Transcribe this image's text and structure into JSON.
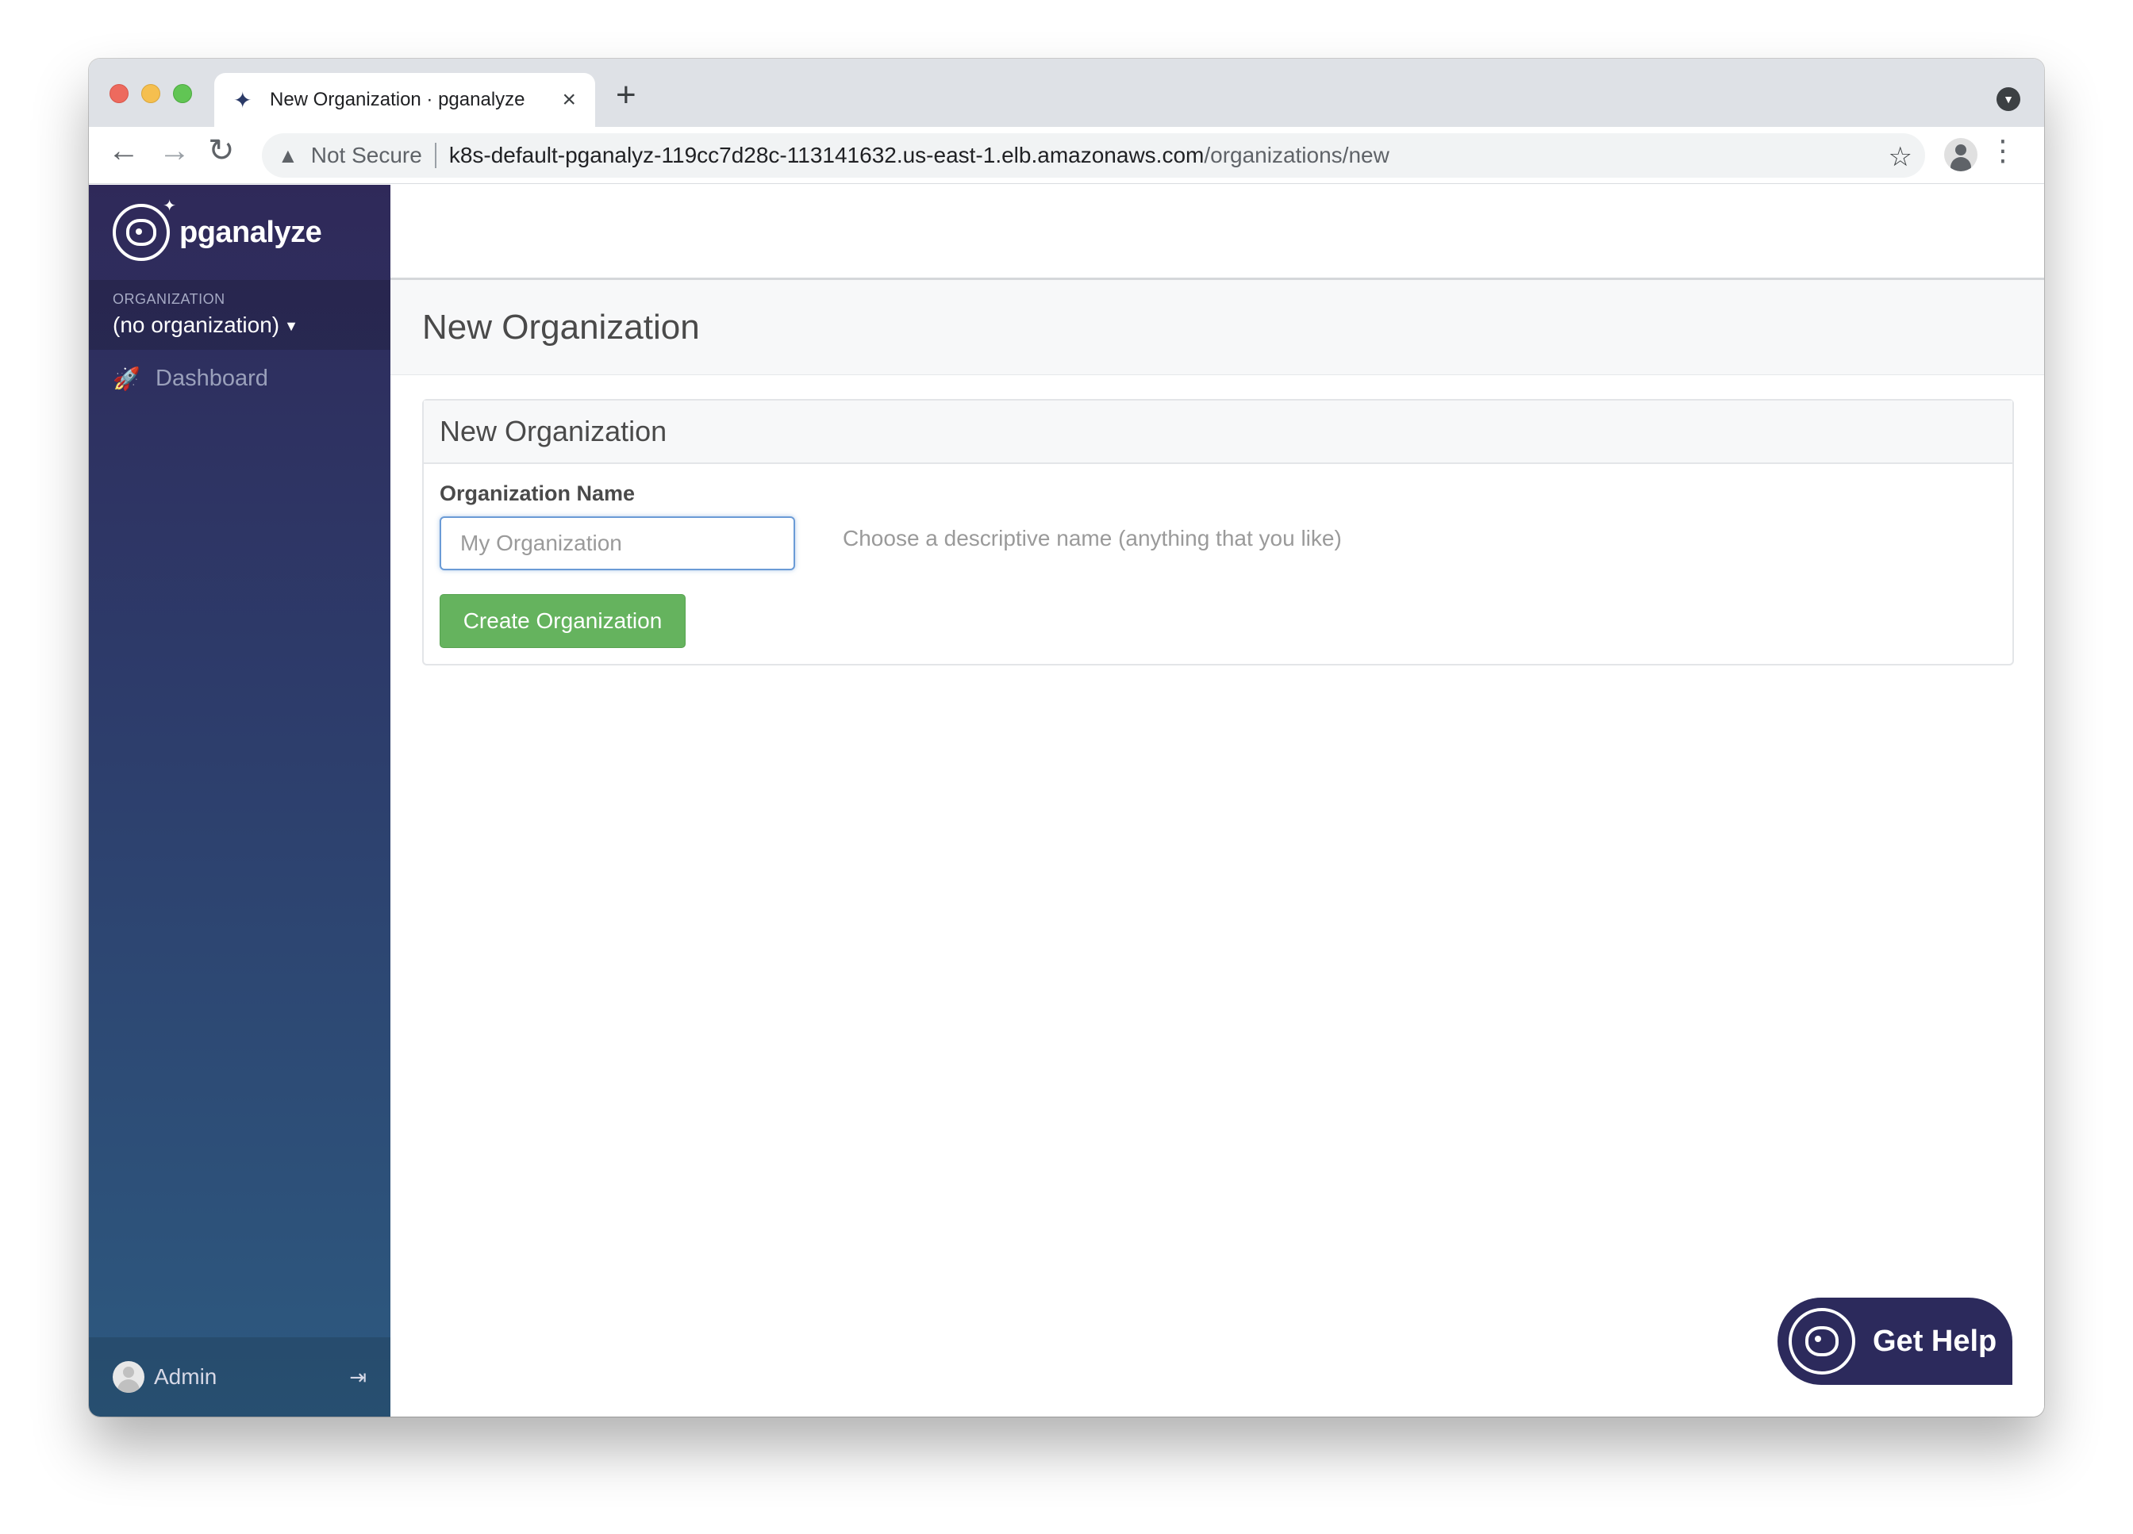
{
  "browser": {
    "tab_title": "New Organization · pganalyze",
    "security_label": "Not Secure",
    "url_host": "k8s-default-pganalyz-119cc7d28c-113141632.us-east-1.elb.amazonaws.com",
    "url_path": "/organizations/new"
  },
  "sidebar": {
    "brand_name": "pganalyze",
    "org_label": "ORGANIZATION",
    "org_value": "(no organization)",
    "nav_items": [
      {
        "label": "Dashboard",
        "icon": "rocket-icon"
      }
    ],
    "user_name": "Admin"
  },
  "page": {
    "title": "New Organization",
    "panel_title": "New Organization",
    "field_label": "Organization Name",
    "input_placeholder": "My Organization",
    "input_value": "",
    "field_help": "Choose a descriptive name (anything that you like)",
    "submit_label": "Create Organization"
  },
  "help_widget": {
    "label": "Get Help"
  },
  "colors": {
    "sidebar_top": "#2f2959",
    "sidebar_bottom": "#2d5a80",
    "submit_button": "#65b35e",
    "help_button": "#2c2a5c"
  }
}
